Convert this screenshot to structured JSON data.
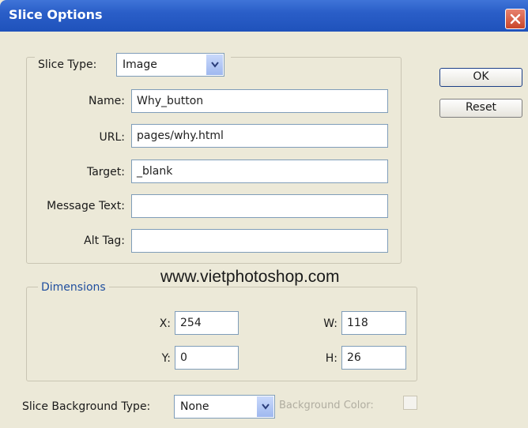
{
  "window": {
    "title": "Slice Options"
  },
  "slice_type": {
    "label": "Slice Type:",
    "value": "Image"
  },
  "fields": [
    {
      "label": "Name:",
      "value": "Why_button"
    },
    {
      "label": "URL:",
      "value": "pages/why.html"
    },
    {
      "label": "Target:",
      "value": "_blank"
    },
    {
      "label": "Message Text:",
      "value": ""
    },
    {
      "label": "Alt Tag:",
      "value": ""
    }
  ],
  "dimensions": {
    "label": "Dimensions",
    "x": {
      "label": "X:",
      "value": "254"
    },
    "y": {
      "label": "Y:",
      "value": "0"
    },
    "w": {
      "label": "W:",
      "value": "118"
    },
    "h": {
      "label": "H:",
      "value": "26"
    }
  },
  "buttons": {
    "ok": "OK",
    "reset": "Reset"
  },
  "watermark": "www.vietphotoshop.com",
  "background": {
    "label": "Slice Background Type:",
    "value": "None",
    "color_label": "Background Color:"
  },
  "colors": {
    "title_bar": "#245edb",
    "dialog_bg": "#ece9d8",
    "accent": "#1f4e9e"
  },
  "icons": {
    "close": "close-icon",
    "dropdown": "chevron-down-icon"
  }
}
